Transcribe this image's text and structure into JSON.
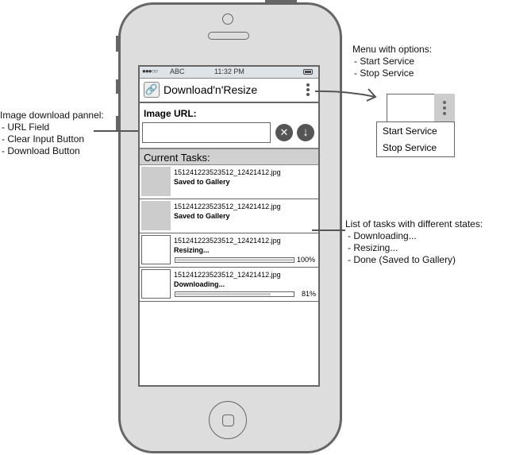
{
  "status_bar": {
    "carrier": "ABC",
    "signal": "●●●○○",
    "time": "11:32 PM",
    "battery_icon": "battery-icon"
  },
  "app_bar": {
    "logo_icon": "link-icon",
    "title": "Download'n'Resize",
    "menu_icon": "kebab-menu-icon"
  },
  "download_panel": {
    "label": "Image URL:",
    "url_value": "",
    "url_placeholder": "",
    "clear_button_icon": "close-circle-icon",
    "clear_glyph": "✕",
    "download_button_icon": "download-arrow-icon",
    "download_glyph": "↓"
  },
  "tasks": {
    "header": "Current Tasks:",
    "items": [
      {
        "filename": "151241223523512_12421412.jpg",
        "status": "Saved to Gallery",
        "has_thumbnail": true,
        "progress": null
      },
      {
        "filename": "151241223523512_12421412.jpg",
        "status": "Saved to Gallery",
        "has_thumbnail": true,
        "progress": null
      },
      {
        "filename": "151241223523512_12421412.jpg",
        "status": "Resizing...",
        "has_thumbnail": false,
        "progress": 100,
        "progress_label": "100%"
      },
      {
        "filename": "151241223523512_12421412.jpg",
        "status": "Downloading...",
        "has_thumbnail": false,
        "progress": 81,
        "progress_label": "81%"
      }
    ]
  },
  "annotations": {
    "download_panel": {
      "title": "Image download pannel:",
      "items": [
        "- URL Field",
        "- Clear Input Button",
        "- Download Button"
      ]
    },
    "menu": {
      "title": "Menu with options:",
      "items": [
        "- Start Service",
        "- Stop Service"
      ]
    },
    "task_list": {
      "title": "List of tasks with different states:",
      "items": [
        "- Downloading...",
        "- Resizing...",
        "- Done (Saved to Gallery)"
      ]
    }
  },
  "menu_mock": {
    "options": [
      "Start Service",
      "Stop Service"
    ]
  },
  "colors": {
    "frame": "#666666",
    "body": "#dddddd",
    "accent_gray": "#cccccc",
    "button": "#555555"
  }
}
